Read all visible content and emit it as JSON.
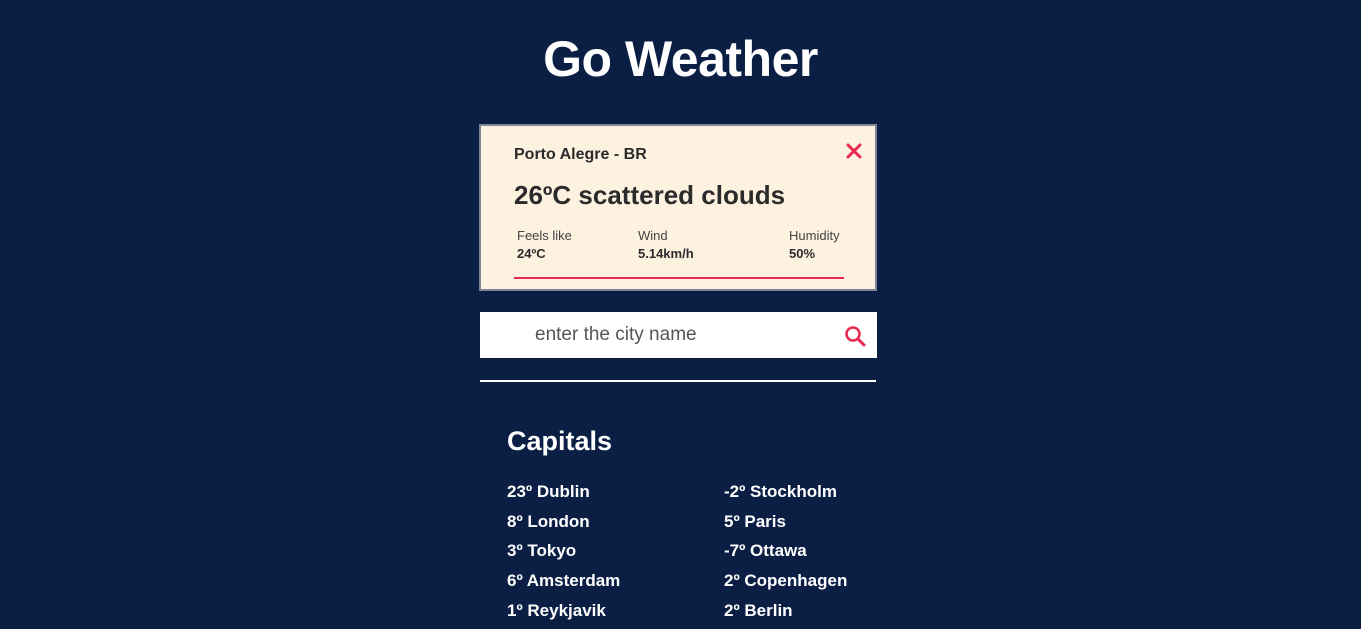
{
  "app": {
    "title": "Go Weather"
  },
  "weather_card": {
    "city": "Porto Alegre - BR",
    "headline": "26ºC scattered clouds",
    "stats": {
      "feels_like": {
        "label": "Feels like",
        "value": "24ºC"
      },
      "wind": {
        "label": "Wind",
        "value": "5.14km/h"
      },
      "humidity": {
        "label": "Humidity",
        "value": "50%"
      }
    },
    "close_icon": "close-icon",
    "accent_color": "#e8294f"
  },
  "search": {
    "placeholder": "enter the city name",
    "value": "",
    "icon": "search-icon"
  },
  "capitals": {
    "title": "Capitals",
    "left": [
      "23º Dublin",
      "8º London",
      "3º Tokyo",
      "6º Amsterdam",
      "1º Reykjavik"
    ],
    "right": [
      "-2º Stockholm",
      "5º Paris",
      "-7º Ottawa",
      "2º Copenhagen",
      "2º Berlin"
    ]
  },
  "colors": {
    "background": "#0b1f45",
    "card": "#fdf1e0",
    "accent": "#e8294f",
    "text_light": "#ffffff"
  }
}
